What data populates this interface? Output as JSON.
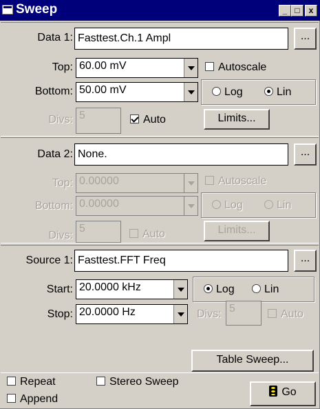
{
  "window": {
    "title": "Sweep",
    "min": "_",
    "max": "□",
    "close": "x"
  },
  "data1": {
    "label": "Data 1:",
    "value": "Fasttest.Ch.1 Ampl",
    "browse": "...",
    "top_label": "Top:",
    "top_value": "60.00  mV",
    "bottom_label": "Bottom:",
    "bottom_value": "50.00  mV",
    "autoscale": "Autoscale",
    "log": "Log",
    "lin": "Lin",
    "divs_label": "Divs:",
    "divs_value": "5",
    "auto": "Auto",
    "limits": "Limits..."
  },
  "data2": {
    "label": "Data 2:",
    "value": "None.",
    "browse": "...",
    "top_label": "Top:",
    "top_value": "0.00000",
    "bottom_label": "Bottom:",
    "bottom_value": "0.00000",
    "autoscale": "Autoscale",
    "log": "Log",
    "lin": "Lin",
    "divs_label": "Divs:",
    "divs_value": "5",
    "auto": "Auto",
    "limits": "Limits..."
  },
  "source1": {
    "label": "Source 1:",
    "value": "Fasttest.FFT Freq",
    "browse": "...",
    "start_label": "Start:",
    "start_value": "20.0000 kHz",
    "stop_label": "Stop:",
    "stop_value": "20.0000  Hz",
    "log": "Log",
    "lin": "Lin",
    "divs_label": "Divs:",
    "divs_value": "5",
    "auto": "Auto"
  },
  "table_sweep": "Table Sweep...",
  "bottom": {
    "repeat": "Repeat",
    "stereo": "Stereo Sweep",
    "append": "Append",
    "go": "Go"
  }
}
